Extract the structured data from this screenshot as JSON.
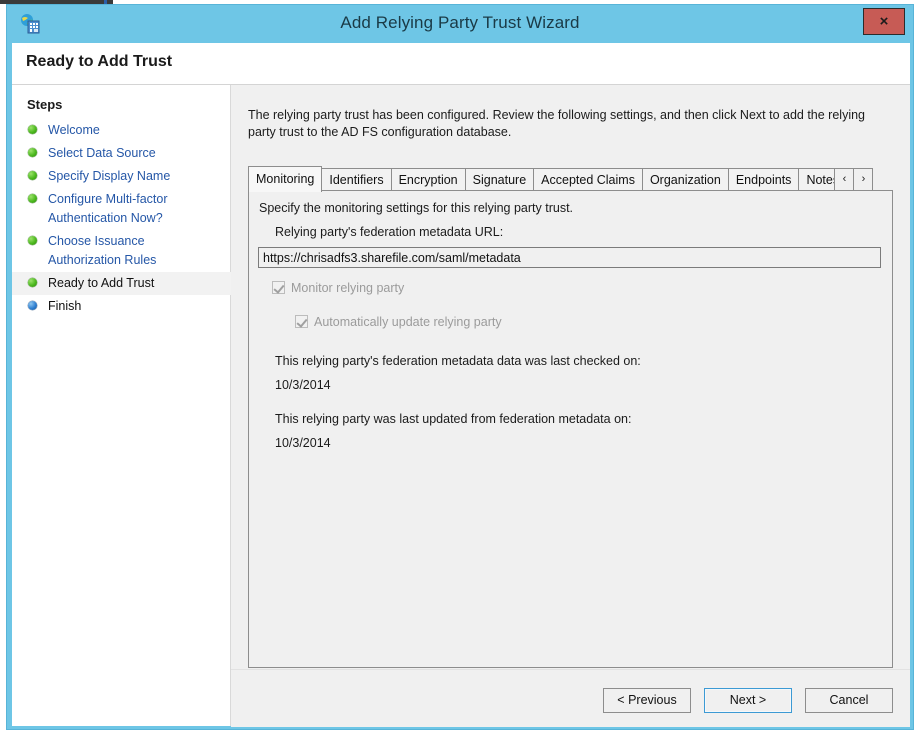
{
  "window": {
    "title": "Add Relying Party Trust Wizard",
    "icon": "adfs-relying-party-icon",
    "close_label": "×",
    "header_title": "Ready to Add Trust"
  },
  "sidebar": {
    "heading": "Steps",
    "items": [
      {
        "label": "Welcome",
        "state": "done",
        "bullet": "green"
      },
      {
        "label": "Select Data Source",
        "state": "done",
        "bullet": "green"
      },
      {
        "label": "Specify Display Name",
        "state": "done",
        "bullet": "green"
      },
      {
        "label": "Configure Multi-factor",
        "label2": "Authentication Now?",
        "state": "done",
        "bullet": "green"
      },
      {
        "label": "Choose Issuance",
        "label2": "Authorization Rules",
        "state": "done",
        "bullet": "green"
      },
      {
        "label": "Ready to Add Trust",
        "state": "current",
        "bullet": "green"
      },
      {
        "label": "Finish",
        "state": "pending",
        "bullet": "blue"
      }
    ]
  },
  "main": {
    "intro": "The relying party trust has been configured. Review the following settings, and then click Next to add the relying party trust to the AD FS configuration database.",
    "tabs": [
      {
        "label": "Monitoring",
        "active": true
      },
      {
        "label": "Identifiers",
        "active": false
      },
      {
        "label": "Encryption",
        "active": false
      },
      {
        "label": "Signature",
        "active": false
      },
      {
        "label": "Accepted Claims",
        "active": false
      },
      {
        "label": "Organization",
        "active": false
      },
      {
        "label": "Endpoints",
        "active": false
      },
      {
        "label": "Notes",
        "active": false,
        "clipped": true
      }
    ],
    "tab_scroll_prev": "‹",
    "tab_scroll_next": "›",
    "monitoring": {
      "description": "Specify the monitoring settings for this relying party trust.",
      "url_label": "Relying party's federation metadata URL:",
      "url_value": "https://chrisadfs3.sharefile.com/saml/metadata",
      "url_placeholder": "",
      "checkbox_monitor": "Monitor relying party",
      "checkbox_monitor_checked": true,
      "checkbox_monitor_enabled": false,
      "checkbox_autoupdate": "Automatically update relying party",
      "checkbox_autoupdate_checked": true,
      "checkbox_autoupdate_enabled": false,
      "last_checked_label": "This relying party's federation metadata data was last checked on:",
      "last_checked_value": "10/3/2014",
      "last_updated_label": "This relying party was last updated from federation metadata on:",
      "last_updated_value": "10/3/2014"
    }
  },
  "footer": {
    "previous": "< Previous",
    "next": "Next >",
    "cancel": "Cancel"
  },
  "colors": {
    "title_bar": "#6ec6e6",
    "close_button": "#c75b55",
    "link_text": "#2557a7",
    "bullet_done": "#4cb81e",
    "bullet_pending": "#2f7fd0",
    "default_button_focus": "#3c9ad4"
  }
}
